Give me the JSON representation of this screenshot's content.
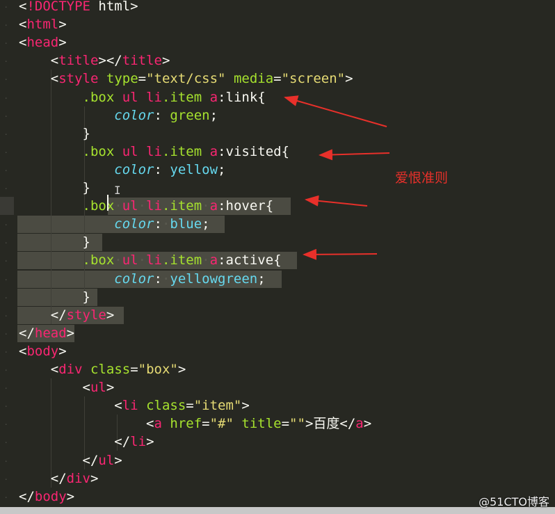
{
  "code": {
    "lines": [
      {
        "t": [
          [
            "ang",
            "<"
          ],
          [
            "tag",
            "!DOCTYPE"
          ],
          [
            "txt",
            " html"
          ],
          [
            "ang",
            ">"
          ]
        ]
      },
      {
        "t": [
          [
            "ang",
            "<"
          ],
          [
            "tag",
            "html"
          ],
          [
            "ang",
            ">"
          ]
        ]
      },
      {
        "t": [
          [
            "ang",
            "<"
          ],
          [
            "tag",
            "head"
          ],
          [
            "ang",
            ">"
          ]
        ]
      },
      {
        "t": [
          [
            "txt",
            "    "
          ],
          [
            "ang",
            "<"
          ],
          [
            "tag",
            "title"
          ],
          [
            "ang",
            "></"
          ],
          [
            "tag",
            "title"
          ],
          [
            "ang",
            ">"
          ]
        ]
      },
      {
        "t": [
          [
            "txt",
            "    "
          ],
          [
            "ang",
            "<"
          ],
          [
            "tag",
            "style"
          ],
          [
            "txt",
            " "
          ],
          [
            "attr",
            "type"
          ],
          [
            "punc",
            "="
          ],
          [
            "str",
            "\"text/css\""
          ],
          [
            "txt",
            " "
          ],
          [
            "attr",
            "media"
          ],
          [
            "punc",
            "="
          ],
          [
            "str",
            "\"screen\""
          ],
          [
            "ang",
            ">"
          ]
        ]
      },
      {
        "t": [
          [
            "txt",
            "        "
          ],
          [
            "cls",
            ".box"
          ],
          [
            "txt",
            " "
          ],
          [
            "tag",
            "ul"
          ],
          [
            "txt",
            " "
          ],
          [
            "tag",
            "li"
          ],
          [
            "cls",
            ".item"
          ],
          [
            "txt",
            " "
          ],
          [
            "tag",
            "a"
          ],
          [
            "punc",
            ":"
          ],
          [
            "txt",
            "link{"
          ]
        ]
      },
      {
        "t": [
          [
            "txt",
            "            "
          ],
          [
            "cprop",
            "color"
          ],
          [
            "punc",
            ": "
          ],
          [
            "val-g",
            "green"
          ],
          [
            "punc",
            ";"
          ]
        ]
      },
      {
        "t": [
          [
            "txt",
            "        "
          ],
          [
            "punc",
            "}"
          ]
        ]
      },
      {
        "t": [
          [
            "txt",
            "        "
          ],
          [
            "cls",
            ".box"
          ],
          [
            "txt",
            " "
          ],
          [
            "tag",
            "ul"
          ],
          [
            "txt",
            " "
          ],
          [
            "tag",
            "li"
          ],
          [
            "cls",
            ".item"
          ],
          [
            "txt",
            " "
          ],
          [
            "tag",
            "a"
          ],
          [
            "punc",
            ":"
          ],
          [
            "txt",
            "visited{"
          ]
        ]
      },
      {
        "t": [
          [
            "txt",
            "            "
          ],
          [
            "cprop",
            "color"
          ],
          [
            "punc",
            ": "
          ],
          [
            "val-b",
            "yellow"
          ],
          [
            "punc",
            ";"
          ]
        ]
      },
      {
        "t": [
          [
            "txt",
            "        "
          ],
          [
            "punc",
            "}"
          ]
        ]
      },
      {
        "t": [
          [
            "txt",
            "        "
          ],
          [
            "cls",
            ".box"
          ],
          [
            "ws",
            "·"
          ],
          [
            "tag",
            "ul"
          ],
          [
            "ws",
            "·"
          ],
          [
            "tag",
            "li"
          ],
          [
            "cls",
            ".item"
          ],
          [
            "ws",
            "·"
          ],
          [
            "tag",
            "a"
          ],
          [
            "punc",
            ":"
          ],
          [
            "txt",
            "hover{"
          ]
        ]
      },
      {
        "t": [
          [
            "txt",
            "            "
          ],
          [
            "cprop",
            "color"
          ],
          [
            "punc",
            ":"
          ],
          [
            "ws",
            "·"
          ],
          [
            "val-b",
            "blue"
          ],
          [
            "punc",
            ";"
          ]
        ]
      },
      {
        "t": [
          [
            "txt",
            "        "
          ],
          [
            "punc",
            "}"
          ]
        ]
      },
      {
        "t": [
          [
            "txt",
            "        "
          ],
          [
            "cls",
            ".box"
          ],
          [
            "ws",
            "·"
          ],
          [
            "tag",
            "ul"
          ],
          [
            "ws",
            "·"
          ],
          [
            "tag",
            "li"
          ],
          [
            "cls",
            ".item"
          ],
          [
            "ws",
            "·"
          ],
          [
            "tag",
            "a"
          ],
          [
            "punc",
            ":"
          ],
          [
            "txt",
            "active{"
          ]
        ]
      },
      {
        "t": [
          [
            "txt",
            "            "
          ],
          [
            "cprop",
            "color"
          ],
          [
            "punc",
            ":"
          ],
          [
            "ws",
            "·"
          ],
          [
            "val-b",
            "yellowgreen"
          ],
          [
            "punc",
            ";"
          ]
        ]
      },
      {
        "t": [
          [
            "txt",
            "        "
          ],
          [
            "punc",
            "}"
          ]
        ]
      },
      {
        "t": [
          [
            "txt",
            "    "
          ],
          [
            "ang",
            "</"
          ],
          [
            "tag",
            "style"
          ],
          [
            "ang",
            ">"
          ]
        ]
      },
      {
        "t": [
          [
            "ang",
            "</"
          ],
          [
            "tag",
            "head"
          ],
          [
            "ang",
            ">"
          ]
        ]
      },
      {
        "t": [
          [
            "ang",
            "<"
          ],
          [
            "tag",
            "body"
          ],
          [
            "ang",
            ">"
          ]
        ]
      },
      {
        "t": [
          [
            "txt",
            "    "
          ],
          [
            "ang",
            "<"
          ],
          [
            "tag",
            "div"
          ],
          [
            "txt",
            " "
          ],
          [
            "attr",
            "class"
          ],
          [
            "punc",
            "="
          ],
          [
            "str",
            "\"box\""
          ],
          [
            "ang",
            ">"
          ]
        ]
      },
      {
        "t": [
          [
            "txt",
            "        "
          ],
          [
            "ang",
            "<"
          ],
          [
            "tag",
            "ul"
          ],
          [
            "ang",
            ">"
          ]
        ]
      },
      {
        "t": [
          [
            "txt",
            "            "
          ],
          [
            "ang",
            "<"
          ],
          [
            "tag",
            "li"
          ],
          [
            "txt",
            " "
          ],
          [
            "attr",
            "class"
          ],
          [
            "punc",
            "="
          ],
          [
            "str",
            "\"item\""
          ],
          [
            "ang",
            ">"
          ]
        ]
      },
      {
        "t": [
          [
            "txt",
            "                "
          ],
          [
            "ang",
            "<"
          ],
          [
            "tag",
            "a"
          ],
          [
            "txt",
            " "
          ],
          [
            "attr",
            "href"
          ],
          [
            "punc",
            "="
          ],
          [
            "str",
            "\"#\""
          ],
          [
            "txt",
            " "
          ],
          [
            "attr",
            "title"
          ],
          [
            "punc",
            "="
          ],
          [
            "str",
            "\"\""
          ],
          [
            "ang",
            ">"
          ],
          [
            "txt",
            "百度"
          ],
          [
            "ang",
            "</"
          ],
          [
            "tag",
            "a"
          ],
          [
            "ang",
            ">"
          ]
        ]
      },
      {
        "t": [
          [
            "txt",
            "            "
          ],
          [
            "ang",
            "</"
          ],
          [
            "tag",
            "li"
          ],
          [
            "ang",
            ">"
          ]
        ]
      },
      {
        "t": [
          [
            "txt",
            "        "
          ],
          [
            "ang",
            "</"
          ],
          [
            "tag",
            "ul"
          ],
          [
            "ang",
            ">"
          ]
        ]
      },
      {
        "t": [
          [
            "txt",
            "    "
          ],
          [
            "ang",
            "</"
          ],
          [
            "tag",
            "div"
          ],
          [
            "ang",
            ">"
          ]
        ]
      },
      {
        "t": [
          [
            "ang",
            "</"
          ],
          [
            "tag",
            "body"
          ],
          [
            "ang",
            ">"
          ]
        ]
      }
    ]
  },
  "annotation": {
    "note": "爱恨准则",
    "color": "#e8302a"
  },
  "watermark": "@51CTO博客",
  "colors": {
    "background": "#272822",
    "tag": "#f92672",
    "attr": "#a6e22e",
    "string": "#e6db74",
    "property": "#66d9ef"
  }
}
